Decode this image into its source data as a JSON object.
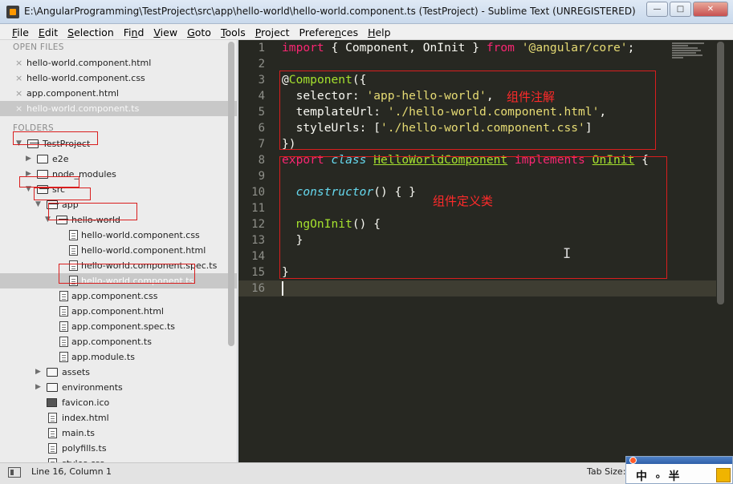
{
  "window": {
    "title": "E:\\AngularProgramming\\TestProject\\src\\app\\hello-world\\hello-world.component.ts (TestProject) - Sublime Text (UNREGISTERED)",
    "minimize": "—",
    "maximize": "□",
    "close": "✕"
  },
  "menu": {
    "file": {
      "u": "F",
      "rest": "ile"
    },
    "edit": {
      "u": "E",
      "rest": "dit"
    },
    "selection": {
      "u": "S",
      "rest": "election"
    },
    "find": {
      "u": "F",
      "rest": "ind",
      "pre": "Fi",
      "post": "d",
      "uu": "n"
    },
    "view": {
      "u": "V",
      "rest": "iew"
    },
    "goto": {
      "u": "G",
      "rest": "oto"
    },
    "tools": {
      "u": "T",
      "rest": "ools"
    },
    "project": {
      "u": "P",
      "rest": "roject"
    },
    "preferences": {
      "u": "n",
      "pre": "Prefere",
      "post": "ces"
    },
    "help": {
      "u": "H",
      "rest": "elp"
    }
  },
  "sidebar": {
    "open_files_header": "OPEN FILES",
    "open_files": [
      "hello-world.component.html",
      "hello-world.component.css",
      "app.component.html",
      "hello-world.component.ts"
    ],
    "close_glyph": "×",
    "folders_header": "FOLDERS",
    "tree": {
      "project": "TestProject",
      "e2e": "e2e",
      "node_modules": "node_modules",
      "src": "src",
      "app": "app",
      "hello_world": "hello-world",
      "hw_files": [
        "hello-world.component.css",
        "hello-world.component.html",
        "hello-world.component.spec.ts",
        "hello-world.component.ts"
      ],
      "app_files": [
        "app.component.css",
        "app.component.html",
        "app.component.spec.ts",
        "app.component.ts",
        "app.module.ts"
      ],
      "assets": "assets",
      "environments": "environments",
      "root_files": [
        "favicon.ico",
        "index.html",
        "main.ts",
        "polyfills.ts",
        "styles.css"
      ]
    }
  },
  "editor": {
    "line_numbers": [
      "1",
      "2",
      "3",
      "4",
      "5",
      "6",
      "7",
      "8",
      "9",
      "10",
      "11",
      "12",
      "13",
      "14",
      "15",
      "16"
    ],
    "code": {
      "l1_import": "import",
      "l1_a": " { Component, OnInit } ",
      "l1_from": "from",
      "l1_sp": " ",
      "l1_str": "'@angular/core'",
      "l1_end": ";",
      "l3_a": "@",
      "l3_fn": "Component",
      "l3_b": "({",
      "l4_a": "  selector: ",
      "l4_str": "'app-hello-world'",
      "l4_b": ",",
      "l5_a": "  templateUrl: ",
      "l5_str": "'./hello-world.component.html'",
      "l5_b": ",",
      "l6_a": "  styleUrls: [",
      "l6_str": "'./hello-world.component.css'",
      "l6_b": "]",
      "l7": "})",
      "l8_export": "export",
      "l8_sp1": " ",
      "l8_class": "class",
      "l8_sp2": " ",
      "l8_name": "HelloWorldComponent",
      "l8_sp3": " ",
      "l8_impl": "implements",
      "l8_sp4": " ",
      "l8_iface": "OnInit",
      "l8_end": " {",
      "l10_a": "  ",
      "l10_fn": "constructor",
      "l10_b": "() { }",
      "l12_a": "  ",
      "l12_fn": "ngOnInit",
      "l12_b": "() {",
      "l13": "  }",
      "l15": "}"
    },
    "note_decorator": "组件注解",
    "note_class": "组件定义类",
    "ibeam": "I"
  },
  "status": {
    "position": "Line 16, Column 1",
    "tab_size": "Tab Size:"
  },
  "ime": {
    "text": "中 ∘ 半"
  },
  "colors": {
    "editor_bg": "#272822",
    "keyword": "#f92672",
    "string": "#e6db74",
    "function": "#a6e22e",
    "annotation_red": "#d91e1e"
  }
}
